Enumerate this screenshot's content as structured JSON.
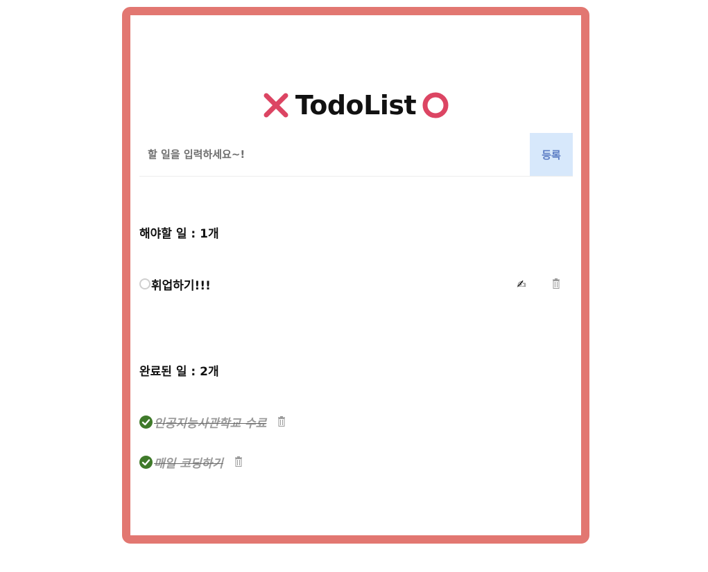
{
  "app": {
    "title": "TodoList",
    "left_icon": "x-mark-icon",
    "right_icon": "circle-o-icon",
    "accent_color": "#dc4563",
    "frame_color": "#e27771"
  },
  "input": {
    "placeholder": "할 일을 입력하세요~!",
    "value": "",
    "add_label": "등록"
  },
  "todo_section": {
    "heading": "해야할 일 : 1개",
    "items": [
      {
        "text": "휘업하기!!!",
        "edit_icon": "writing-hand-icon",
        "delete_icon": "trash-icon"
      }
    ]
  },
  "done_section": {
    "heading": "완료된 일 : 2개",
    "items": [
      {
        "text": "인공지능사관학교 수료",
        "check_icon": "check-circle-icon",
        "delete_icon": "trash-icon"
      },
      {
        "text": "매일 코딩하기",
        "check_icon": "check-circle-icon",
        "delete_icon": "trash-icon"
      }
    ]
  },
  "edit_glyph": "✍"
}
